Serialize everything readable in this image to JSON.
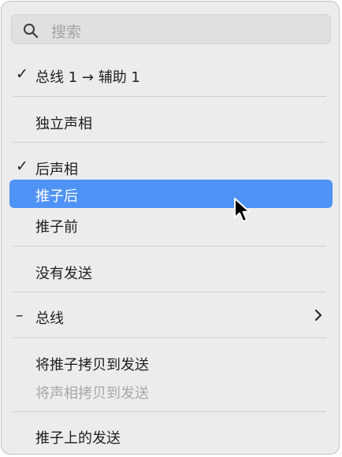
{
  "search": {
    "placeholder": "搜索"
  },
  "items": [
    {
      "label": "总线 1 → 辅助 1",
      "mark": "✓"
    },
    {
      "label": "独立声相"
    },
    {
      "label": "后声相",
      "mark": "✓"
    },
    {
      "label": "推子后",
      "highlighted": true
    },
    {
      "label": "推子前"
    },
    {
      "label": "没有发送"
    },
    {
      "label": "总线",
      "mark": "–",
      "submenu": true
    },
    {
      "label": "将推子拷贝到发送"
    },
    {
      "label": "将声相拷贝到发送",
      "disabled": true
    },
    {
      "label": "推子上的发送"
    }
  ],
  "colors": {
    "highlight": "#4f93f6",
    "menu_bg": "#ececec",
    "disabled_text": "#a8a8a8"
  }
}
